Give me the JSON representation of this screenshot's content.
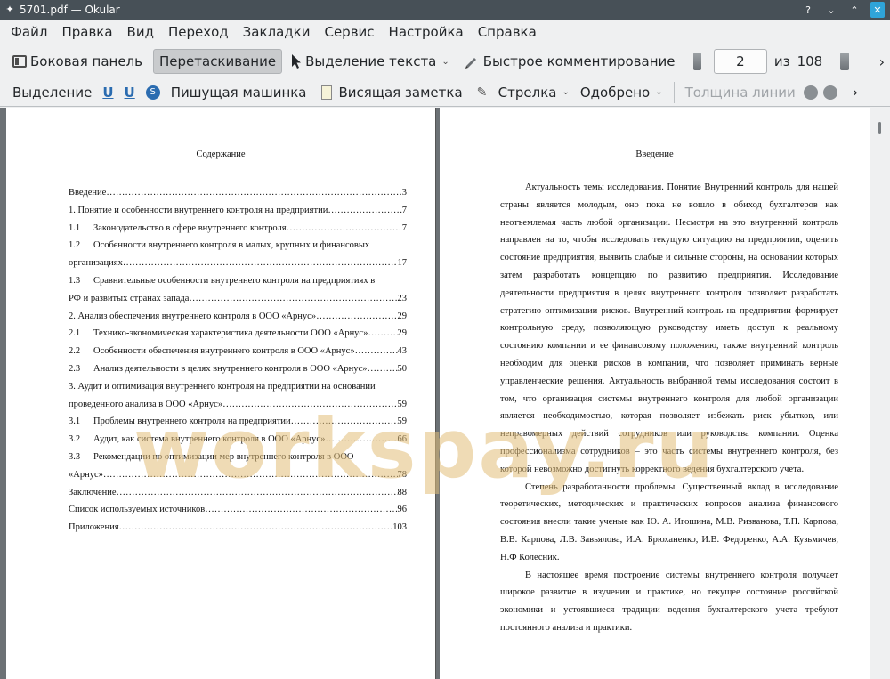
{
  "window": {
    "title": "5701.pdf — Okular"
  },
  "menu": [
    "Файл",
    "Правка",
    "Вид",
    "Переход",
    "Закладки",
    "Сервис",
    "Настройка",
    "Справка"
  ],
  "toolbar1": {
    "side_panel": "Боковая панель",
    "drag": "Перетаскивание",
    "text_select": "Выделение текста",
    "quick_annot": "Быстрое комментирование",
    "page_current": "2",
    "page_of": "из",
    "page_total": "108"
  },
  "toolbar2": {
    "highlight": "Выделение",
    "typewriter": "Пишущая машинка",
    "note": "Висящая заметка",
    "arrow": "Стрелка",
    "approved": "Одобрено",
    "line_width": "Толщина линии"
  },
  "left_page": {
    "title": "Содержание",
    "toc": [
      {
        "num": "",
        "text": "Введение",
        "page": "3"
      },
      {
        "num": "",
        "text": "1. Понятие и особенности внутреннего контроля на предприятии",
        "page": "7"
      },
      {
        "num": "1.1",
        "text": "Законодательство в сфере  внутреннего контроля",
        "page": "7"
      },
      {
        "num": "1.2",
        "text": "Особенности внутреннего контроля в малых, крупных и финансовых",
        "cont": "организациях",
        "page": "17"
      },
      {
        "num": "1.3",
        "text": "Сравнительные особенности внутреннего контроля на предприятиях в",
        "cont": "РФ и развитых странах запада",
        "page": "23"
      },
      {
        "num": "",
        "text": "2. Анализ обеспечения внутреннего контроля в ООО «Арнус»",
        "page": "29"
      },
      {
        "num": "2.1",
        "text": "Технико-экономическая характеристика деятельности ООО «Арнус»",
        "page": "29"
      },
      {
        "num": "2.2",
        "text": "Особенности обеспечения внутреннего контроля в ООО «Арнус»",
        "page": "43"
      },
      {
        "num": "2.3",
        "text": "Анализ деятельности в целях внутреннего контроля в ООО «Арнус»",
        "page": "50"
      },
      {
        "num": "",
        "text": "3. Аудит и оптимизация внутреннего контроля на предприятии на основании",
        "cont": "проведенного анализа в ООО «Арнус»",
        "page": "59"
      },
      {
        "num": "3.1",
        "text": "Проблемы внутреннего контроля  на предприятии",
        "page": "59"
      },
      {
        "num": "3.2",
        "text": "Аудит, как система внутреннего контроля в ООО «Арнус»",
        "page": "66"
      },
      {
        "num": "3.3",
        "text": "Рекомендации по оптимизации мер внутреннего контроля в ООО",
        "cont": "«Арнус»",
        "page": "78"
      },
      {
        "num": "",
        "text": "Заключение",
        "page": "88"
      },
      {
        "num": "",
        "text": "Список используемых источников",
        "page": "96"
      },
      {
        "num": "",
        "text": "Приложения",
        "page": "103"
      }
    ]
  },
  "right_page": {
    "title": "Введение",
    "paragraphs": [
      "Актуальность темы исследования. Понятие Внутренний контроль для нашей страны является молодым, оно пока не вошло в обиход бухгалтеров как неотъемлемая часть любой организации. Несмотря на это внутренний контроль направлен на то, чтобы исследовать текущую ситуацию на предприятии, оценить состояние предприятия, выявить слабые и сильные стороны, на основании которых затем разработать концепцию по развитию предприятия. Исследование деятельности предприятия в целях внутреннего контроля позволяет разработать стратегию оптимизации рисков. Внутренний контроль на предприятии формирует контрольную среду, позволяющую руководству иметь доступ к реальному состоянию компании и ее финансовому положению, также внутренний контроль необходим для оценки рисков в компании, что позволяет приминать верные управленческие решения. Актуальность выбранной темы исследования состоит в том, что организация системы внутреннего контроля для любой организации является необходимостью, которая позволяет избежать риск убытков, или неправомерных действий сотрудников или руководства компании. Оценка профессионализма сотрудников – это часть системы внутреннего контроля, без которой невозможно достигнуть корректного ведения бухгалтерского учета.",
      "Степень разработанности проблемы. Существенный вклад в исследование теоретических, методических и практических вопросов анализа финансового состояния внесли такие ученые как Ю. А. Игошина, М.В. Ризванова, Т.П. Карпова, В.В. Карпова, Л.В. Завьялова, И.А. Брюханенко, И.В. Федоренко, А.А. Кузьмичев, Н.Ф Колесник.",
      "В настоящее время построение системы внутреннего контроля получает широкое развитие в изучении и практике, но текущее состояние российской экономики и устоявшиеся традиции ведения бухгалтерского учета требуют постоянного анализа и практики."
    ]
  },
  "watermark": "workspay.ru"
}
